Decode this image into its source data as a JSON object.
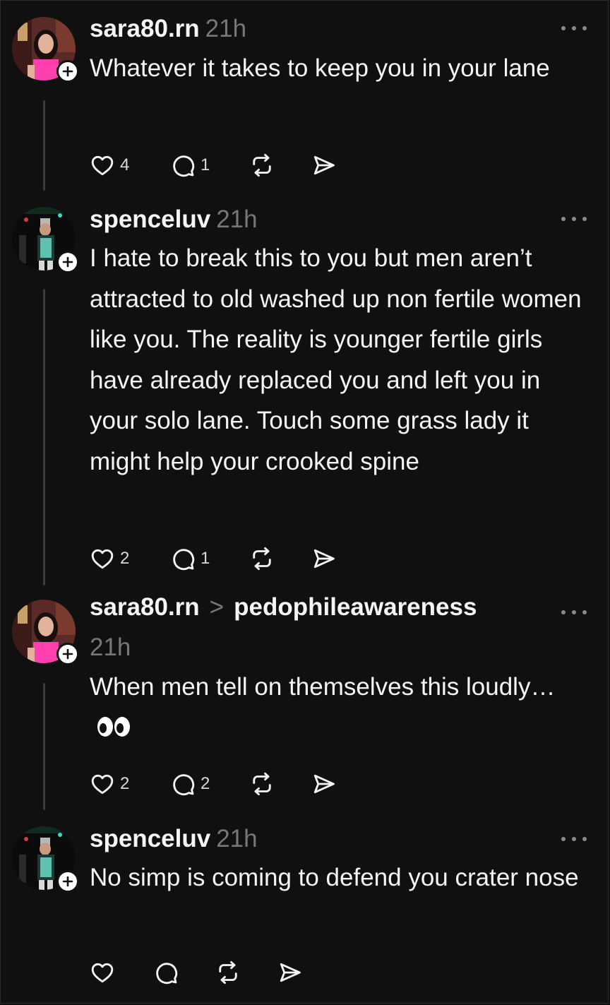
{
  "posts": [
    {
      "username": "sara80.rn",
      "time": "21h",
      "text": "Whatever it takes to keep you in your lane",
      "likes": "4",
      "replies": "1"
    },
    {
      "username": "spenceluv",
      "time": "21h",
      "text": "I hate to break this to you but men aren’t attracted to old washed up non fertile women like you. The reality is younger fertile girls have already replaced you and left you in your solo lane. Touch some grass lady it might help your crooked spine",
      "likes": "2",
      "replies": "1"
    },
    {
      "username": "sara80.rn",
      "reply_to": "pedophileawareness",
      "time": "21h",
      "text": "When men tell on themselves this loudly…",
      "emoji": "eyes",
      "likes": "2",
      "replies": "2"
    },
    {
      "username": "spenceluv",
      "time": "21h",
      "text": "No simp is coming to defend you crater nose",
      "likes": "",
      "replies": ""
    }
  ],
  "icons": {
    "like": "heart-icon",
    "reply": "comment-icon",
    "repost": "repost-icon",
    "share": "send-icon",
    "more": "more-options-icon",
    "follow": "plus-icon"
  },
  "colors": {
    "background": "#101010",
    "text": "#f3f5f7",
    "muted": "#777777",
    "thread_line": "#3a3a3a"
  }
}
